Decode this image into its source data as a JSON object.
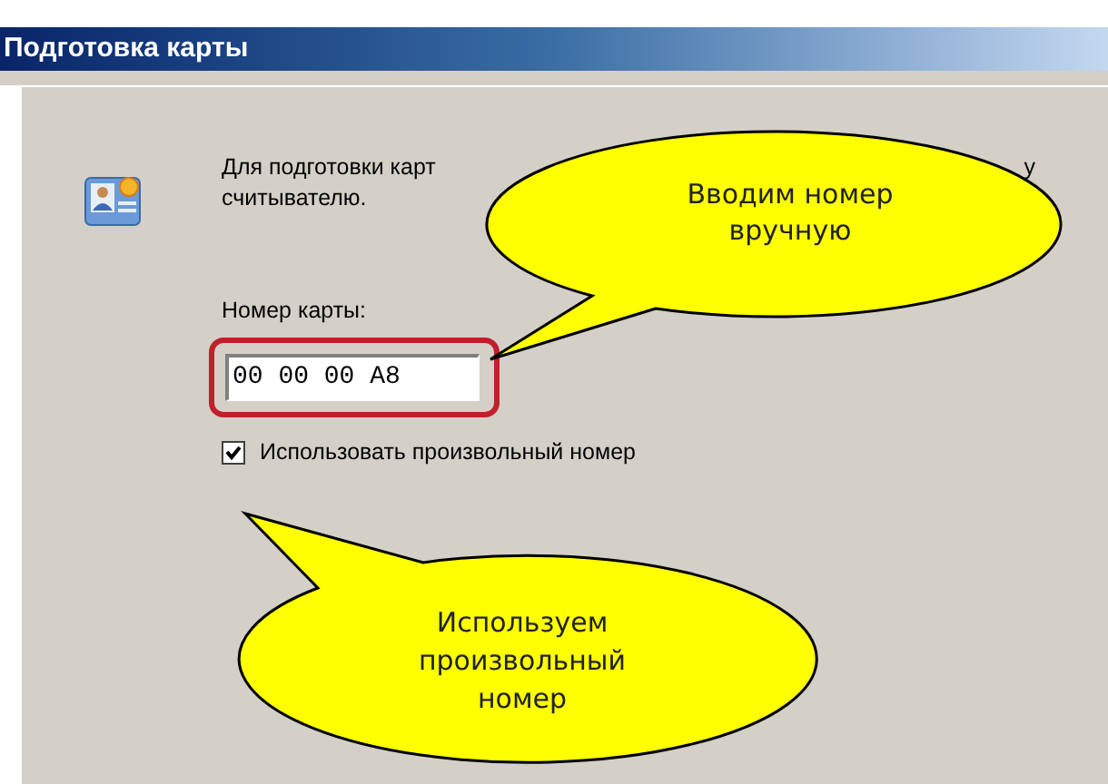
{
  "window": {
    "title": "Подготовка карты"
  },
  "description": {
    "line_1_start": "Для подготовки карт",
    "line_1_end": "у",
    "line_2": "считывателю."
  },
  "card_number": {
    "label": "Номер карты:",
    "value": "00 00 00 A8",
    "highlighted": true
  },
  "custom_number": {
    "label": "Использовать произвольный номер",
    "checked": true
  },
  "callouts": [
    {
      "text": "Вводим номер\nвручную"
    },
    {
      "text": "Используем\nпроизвольный\nномер"
    }
  ]
}
